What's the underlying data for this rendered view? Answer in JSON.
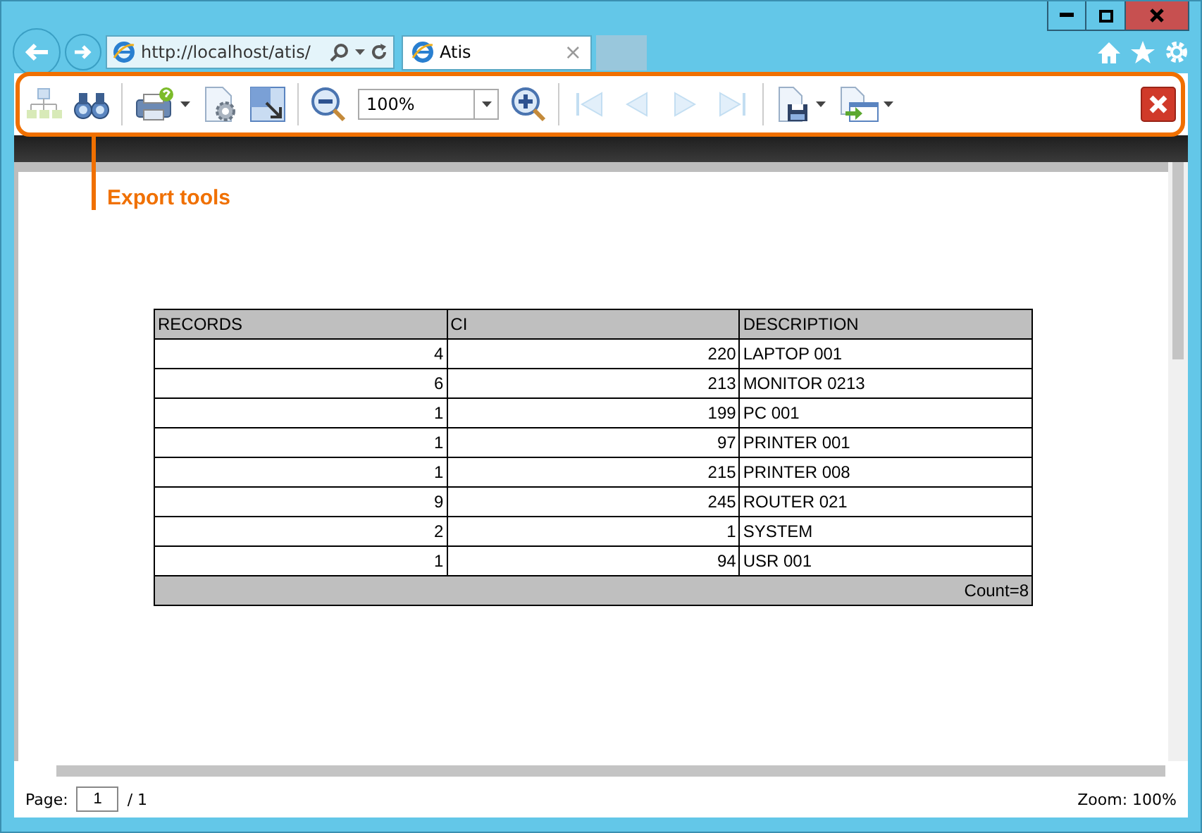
{
  "browser": {
    "address": "http://localhost/atis/",
    "tab": {
      "title": "Atis",
      "close": "×"
    }
  },
  "toolbar": {
    "zoom": "100%",
    "nav_buttons": [
      {
        "disabled": true
      },
      {
        "disabled": true
      },
      {
        "disabled": true
      },
      {
        "disabled": true
      }
    ]
  },
  "annotation": "Export tools",
  "table": {
    "columns": [
      "RECORDS",
      "CI",
      "DESCRIPTION"
    ],
    "rows": [
      [
        "4",
        "220",
        "LAPTOP 001"
      ],
      [
        "6",
        "213",
        "MONITOR 0213"
      ],
      [
        "1",
        "199",
        "PC 001"
      ],
      [
        "1",
        "97",
        "PRINTER 001"
      ],
      [
        "1",
        "215",
        "PRINTER 008"
      ],
      [
        "9",
        "245",
        "ROUTER 021"
      ],
      [
        "2",
        "1",
        "SYSTEM"
      ],
      [
        "1",
        "94",
        "USR 001"
      ]
    ],
    "footer": "Count=8"
  },
  "status_bar": {
    "page_label": "Page:",
    "page": "1",
    "page_total": "/ 1",
    "zoom": "Zoom: 100%"
  }
}
